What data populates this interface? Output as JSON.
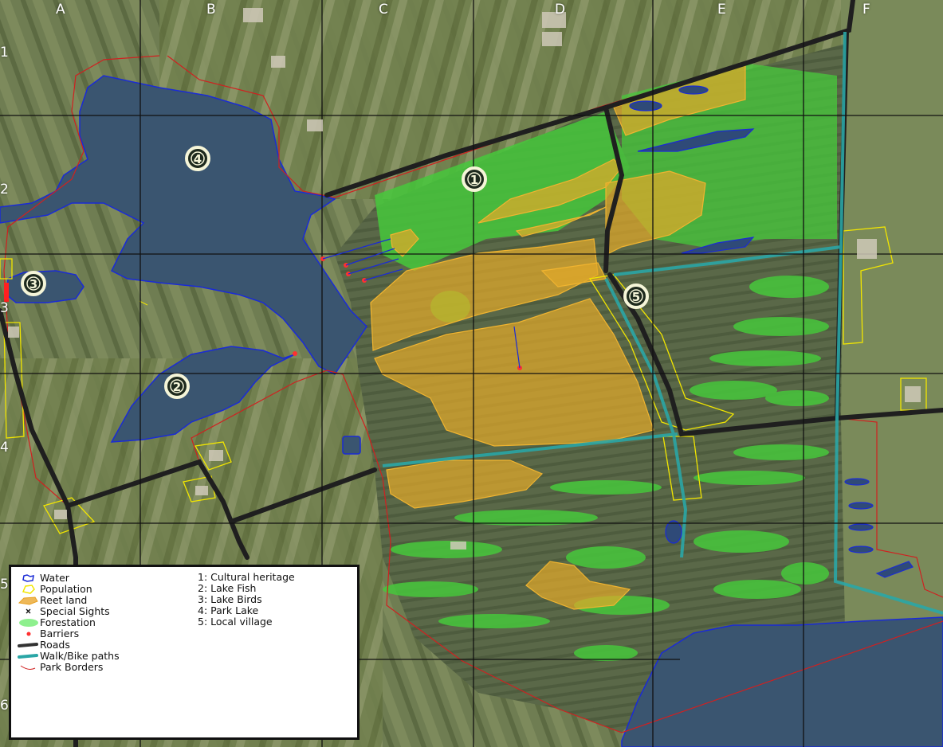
{
  "grid": {
    "columns": [
      "A",
      "B",
      "C",
      "D",
      "E",
      "F"
    ],
    "rows": [
      "1",
      "2",
      "3",
      "4",
      "5",
      "6"
    ]
  },
  "markers": [
    "1",
    "2",
    "3",
    "4",
    "5"
  ],
  "legend": {
    "symbols": [
      {
        "label": "Water",
        "icon": "water-outline-icon",
        "color": "#1a2bd6"
      },
      {
        "label": "Population",
        "icon": "population-outline-icon",
        "color": "#f2e600"
      },
      {
        "label": "Reet land",
        "icon": "reet-land-fill-icon",
        "color": "#e8a020"
      },
      {
        "label": "Special Sights",
        "icon": "x-mark-icon",
        "color": "#111111"
      },
      {
        "label": "Forestation",
        "icon": "forestation-fill-icon",
        "color": "#8ef08e"
      },
      {
        "label": "Barriers",
        "icon": "red-dot-icon",
        "color": "#ff3030"
      },
      {
        "label": "Roads",
        "icon": "road-line-icon",
        "color": "#333333"
      },
      {
        "label": "Walk/Bike paths",
        "icon": "path-line-icon",
        "color": "#2aa6a6"
      },
      {
        "label": "Park Borders",
        "icon": "border-line-icon",
        "color": "#d02020"
      }
    ],
    "numbered": [
      "1: Cultural heritage",
      "2: Lake Fish",
      "3: Lake Birds",
      "4: Park Lake",
      "5: Local village"
    ]
  }
}
